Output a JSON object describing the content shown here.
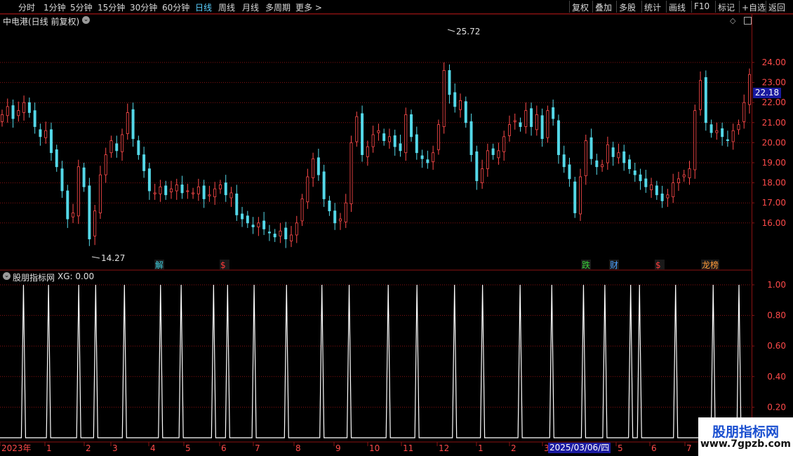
{
  "toolbar": {
    "periods": [
      "分时",
      "1分钟",
      "5分钟",
      "15分钟",
      "30分钟",
      "60分钟",
      "日线",
      "周线",
      "月线",
      "多周期",
      "更多 >"
    ],
    "active_period": "日线",
    "right_buttons": [
      "复权",
      "叠加",
      "多股",
      "统计",
      "画线",
      "F10",
      "标记",
      "+自选",
      "返回"
    ]
  },
  "main_chart": {
    "title": "中电港(日线 前复权)",
    "current_price": "22.18",
    "high_label": "25.72",
    "low_label": "14.27",
    "price_ticks": [
      "24.00",
      "23.00",
      "22.00",
      "21.00",
      "20.00",
      "19.00",
      "18.00",
      "17.00",
      "16.00"
    ],
    "event_markers": [
      {
        "text": "解",
        "color": "#3fd0e0"
      },
      {
        "text": "$",
        "color": "#ff3a3a"
      },
      {
        "text": "跌",
        "color": "#3ad03a"
      },
      {
        "text": "财",
        "color": "#4aa0ff"
      },
      {
        "text": "$",
        "color": "#ff3a3a"
      },
      {
        "text": "龙榜",
        "color": "#ff9a3a"
      }
    ]
  },
  "indicator": {
    "title": "股朋指标网",
    "xg_label": "XG: 0.00",
    "ticks": [
      "1.00",
      "0.80",
      "0.60",
      "0.40",
      "0.20"
    ]
  },
  "x_axis": {
    "labels": [
      "2023年",
      "1",
      "2",
      "3",
      "4",
      "5",
      "6",
      "7",
      "8",
      "9",
      "10",
      "11",
      "12",
      "1",
      "2",
      "3",
      "5",
      "6",
      "7"
    ],
    "cursor_date": "2025/03/06/四"
  },
  "watermark": {
    "title": "股朋指标网",
    "url": "www.7gpzb.com"
  },
  "colors": {
    "up": "#ff4a4a",
    "down": "#54d8e8",
    "grid": "#8a1212",
    "axis_text": "#ff4a4a",
    "signal": "#ffffff"
  },
  "chart_data": {
    "type": "candlestick",
    "title": "中电港(日线 前复权)",
    "y_range": [
      14.27,
      25.72
    ],
    "close_series_approx": [
      21.4,
      21.8,
      21.2,
      21.6,
      22.0,
      21.5,
      20.8,
      20.3,
      20.6,
      19.5,
      18.8,
      17.6,
      16.2,
      16.5,
      18.8,
      17.8,
      15.2,
      16.6,
      18.4,
      19.4,
      20.1,
      19.6,
      20.4,
      21.5,
      20.2,
      19.4,
      18.6,
      17.6,
      17.5,
      17.8,
      17.4,
      17.7,
      17.9,
      17.5,
      17.6,
      17.5,
      17.8,
      17.2,
      17.4,
      17.7,
      17.9,
      17.4,
      17.5,
      16.4,
      16.2,
      16.0,
      15.8,
      16.0,
      15.7,
      15.5,
      15.3,
      15.6,
      15.2,
      15.4,
      16.0,
      17.2,
      18.3,
      19.2,
      18.4,
      17.2,
      16.6,
      16.0,
      16.2,
      17.0,
      20.0,
      21.3,
      19.4,
      19.8,
      20.4,
      20.6,
      20.1,
      20.3,
      19.8,
      19.6,
      21.4,
      20.3,
      19.5,
      19.2,
      19.0,
      19.5,
      20.9,
      23.6,
      22.4,
      21.8,
      22.1,
      21.0,
      19.4,
      18.1,
      18.7,
      19.6,
      19.4,
      19.6,
      20.3,
      20.9,
      21.1,
      20.8,
      21.6,
      20.8,
      21.4,
      20.2,
      21.6,
      21.2,
      19.4,
      18.8,
      18.2,
      16.5,
      18.3,
      20.1,
      19.2,
      18.8,
      18.9,
      19.9,
      19.3,
      19.5,
      19.0,
      18.7,
      18.4,
      18.1,
      17.8,
      17.9,
      17.4,
      17.1,
      17.4,
      18.0,
      18.2,
      18.4,
      18.7,
      21.6,
      23.1,
      21.0,
      20.5,
      20.6,
      20.3,
      20.1,
      20.6,
      20.9,
      22.0,
      23.4
    ],
    "signal_x_fraction": [
      0.029,
      0.063,
      0.104,
      0.127,
      0.166,
      0.215,
      0.243,
      0.287,
      0.306,
      0.342,
      0.386,
      0.434,
      0.471,
      0.524,
      0.563,
      0.614,
      0.652,
      0.703,
      0.746,
      0.789,
      0.818,
      0.853,
      0.865,
      0.914,
      0.965,
      1.0
    ]
  }
}
